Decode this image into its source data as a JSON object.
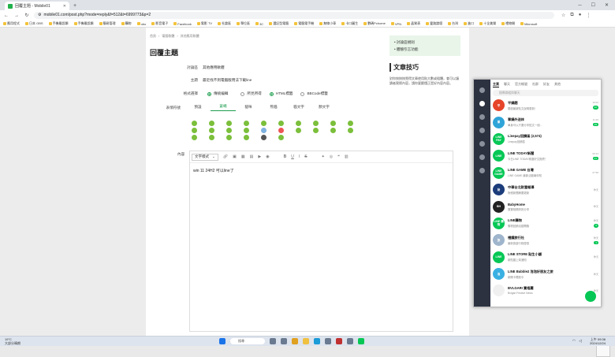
{
  "browser": {
    "tab_title": "回覆主題 - Mobile01",
    "url": "mobile01.com/post.php?mode=reply&f=512&t=6999773&p=2",
    "bookmarks": [
      "應用程式",
      "日本 GBS",
      "手機最設顯",
      "手機最設顯",
      "簡易管理",
      "購物",
      "obo",
      "影音電子",
      "Facebook",
      "電影 TV",
      "社論區",
      "單位區",
      "3C",
      "選記型電腦",
      "電腦電手機",
      "無線小車",
      "卡口圖生",
      "數碼Pchome",
      "VPN",
      "晶質表",
      "靈路論壇",
      "台灣",
      "進口",
      "十全美樂",
      "禮物開",
      "Microsoft"
    ]
  },
  "page": {
    "breadcrumb": [
      "首頁",
      "電腦軟體",
      "其他應用軟體"
    ],
    "title": "回覆主題",
    "forum_label": "討論區",
    "forum_value": "其他應用軟體",
    "subject_label": "主題",
    "subject_value": "最近找不到電腦版用法下載line",
    "mode_label": "格式選擇",
    "modes": [
      "傳統編輯",
      "所見所得",
      "HTML標籤",
      "BBCode標籤"
    ],
    "emoji_label": "表情符號",
    "emoji_tabs": [
      "預設",
      "蒼蠅",
      "貓咪",
      "熊貓",
      "貓文字",
      "顏文字"
    ],
    "editor_label": "內容",
    "format_select": "文字樣式",
    "editor_text": "win 11 24H2 可以line了"
  },
  "sidebar": {
    "links": [
      "討論區規則",
      "體驗引言功能"
    ],
    "heading": "文章技巧",
    "tip": "對你按按按覺得文章使用貼大數或粗體，會可以讓讀者實際內容，請你要聽懂正是好內容內容。"
  },
  "line_app": {
    "tabs": [
      "主頁",
      "聊天",
      "官方帳號",
      "社群",
      "好友",
      "其他"
    ],
    "search_placeholder": "搜尋群組與聊天",
    "chats": [
      {
        "name": "平鍋閥",
        "msg": "閱讀最新貼文說明更新！",
        "time": "10:02",
        "badge": "12",
        "color": "#e6452a",
        "abbr": "平"
      },
      {
        "name": "單鍋外送林",
        "msg": "單身可以只要分享貼文一個...",
        "time": "11:20",
        "badge": "15",
        "color": "#2fa4d8",
        "abbr": "單"
      },
      {
        "name": "Linepay回饋區 (2,574)",
        "msg": "Linepay回饋區",
        "time": "",
        "badge": "",
        "color": "#06c755",
        "abbr": "LINE PAY"
      },
      {
        "name": "LINE TODAY新聞",
        "msg": "今日LINE TODAY精選好文推薦！",
        "time": "09:14",
        "badge": "21",
        "color": "#06c755",
        "abbr": "LINE"
      },
      {
        "name": "LINE GAME 台灣",
        "msg": "LINE GAME 最新活動報你知",
        "time": "07:58",
        "badge": "",
        "color": "#06c755",
        "abbr": "LINE GAME"
      },
      {
        "name": "中華台北財富報導",
        "msg": "財經新聞摘要更新",
        "time": "昨天",
        "badge": "",
        "color": "#1c3c7a",
        "abbr": "財"
      },
      {
        "name": "BabyHome",
        "msg": "寶寶相關資訊分享",
        "time": "昨天",
        "badge": "",
        "color": "#222",
        "abbr": "BH"
      },
      {
        "name": "LINE購物",
        "msg": "購物回饋活動開跑",
        "time": "昨天",
        "badge": "9",
        "color": "#06c755",
        "abbr": "LINE 購物"
      },
      {
        "name": "禮讀旅行社",
        "msg": "最新旅遊行程優惠",
        "time": "昨天",
        "badge": "1",
        "color": "#9fb5cc",
        "abbr": "旅"
      },
      {
        "name": "LINE STORE 貼生小舖",
        "msg": "新貼圖上架通知",
        "time": "昨天",
        "badge": "",
        "color": "#06c755",
        "abbr": "LINE"
      },
      {
        "name": "LINE Bubble2 泡泡好朋友之旅",
        "msg": "新關卡開放中",
        "time": "昨天",
        "badge": "",
        "color": "#3ab0e2",
        "abbr": "泡"
      },
      {
        "name": "BVLGARI 寶格麗",
        "msg": "Bvlgari Festive News",
        "time": "昨天",
        "badge": "",
        "color": "#f0f0f0",
        "abbr": ""
      }
    ]
  },
  "taskbar": {
    "weather_temp": "19°C",
    "weather_text": "大部分晴朗",
    "search": "搜尋",
    "time": "上午 09:36",
    "date": "2024/12/24"
  }
}
